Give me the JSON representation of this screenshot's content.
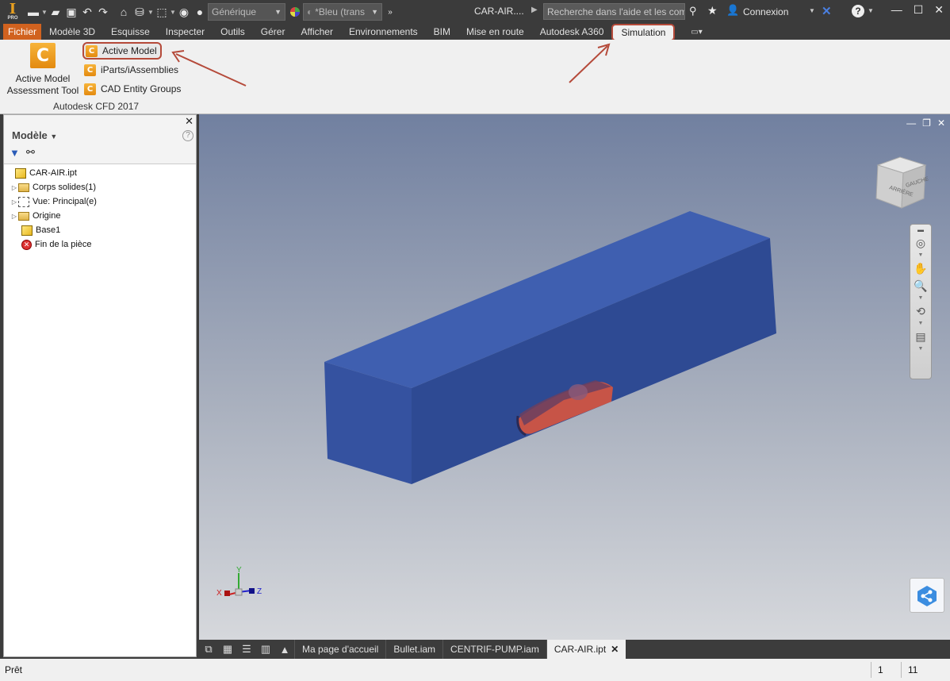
{
  "titlebar": {
    "app_logo": "I",
    "app_logo_sub": "PRO",
    "material_combo": "Générique",
    "appearance_combo": "*Bleu (trans",
    "document_title": "CAR-AIR....",
    "search_placeholder": "Recherche dans l'aide et les com",
    "sign_in": "Connexion"
  },
  "menu": {
    "tabs": [
      "Fichier",
      "Modèle 3D",
      "Esquisse",
      "Inspecter",
      "Outils",
      "Gérer",
      "Afficher",
      "Environnements",
      "BIM",
      "Mise en route",
      "Autodesk A360",
      "Simulation"
    ],
    "active_tab": "Simulation"
  },
  "ribbon": {
    "big_tool_label_1": "Active Model",
    "big_tool_label_2": "Assessment Tool",
    "items": [
      "Active Model",
      "iParts/iAssemblies",
      "CAD Entity Groups"
    ],
    "panel_title": "Autodesk CFD 2017",
    "icon_glyph": "C"
  },
  "browser": {
    "title": "Modèle",
    "tree": [
      {
        "label": "CAR-AIR.ipt",
        "icon": "part-icon",
        "expandable": false,
        "indent": 0
      },
      {
        "label": "Corps solides(1)",
        "icon": "solid-bodies-folder-icon",
        "expandable": true,
        "indent": 1
      },
      {
        "label": "Vue: Principal(e)",
        "icon": "view-rep-icon",
        "expandable": true,
        "indent": 1
      },
      {
        "label": "Origine",
        "icon": "origin-folder-icon",
        "expandable": true,
        "indent": 1
      },
      {
        "label": "Base1",
        "icon": "extrusion-icon",
        "expandable": false,
        "indent": 1
      },
      {
        "label": "Fin de la pièce",
        "icon": "end-of-part-icon",
        "expandable": false,
        "indent": 1
      }
    ]
  },
  "viewcube": {
    "face_left": "ARRIÈRE",
    "face_right": "GAUCHE"
  },
  "triad": {
    "x": "X",
    "y": "Y",
    "z": "Z"
  },
  "colors": {
    "file_tab": "#d1621f",
    "box_blue": "#3b56a0",
    "car_red": "#d8553f",
    "highlight_outline": "#b54a3a",
    "ribbon_icon": "#f0a020"
  },
  "doc_tabs": {
    "tabs": [
      "Ma page d'accueil",
      "Bullet.iam",
      "CENTRIF-PUMP.iam",
      "CAR-AIR.ipt"
    ],
    "active": "CAR-AIR.ipt"
  },
  "status": {
    "text": "Prêt",
    "cell1": "1",
    "cell2": "11"
  }
}
